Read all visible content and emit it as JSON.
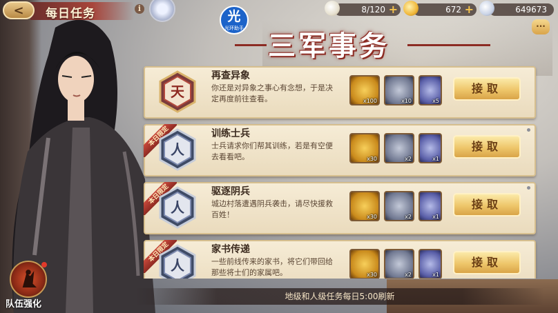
{
  "header": {
    "back_label": "<",
    "title": "每日任务",
    "info_label": "i",
    "logo_glyph": "光",
    "logo_sub": "光环助手",
    "resources": [
      {
        "name": "stamina",
        "value": "8/120",
        "icon": "bun-icon"
      },
      {
        "name": "gold-ingot",
        "value": "672",
        "icon": "gold-ingot-icon"
      },
      {
        "name": "coins",
        "value": "649673",
        "icon": "coin-icon"
      }
    ],
    "plus": "+",
    "chat_label": "···"
  },
  "main_title": "三军事务",
  "tasks": [
    {
      "name": "再查异象",
      "desc": "你还是对异象之事心有念想，于是决定再度前往查看。",
      "grade": "天",
      "ribbon": "",
      "rewards": [
        "x100",
        "x10",
        "x5"
      ],
      "accept": "接取"
    },
    {
      "name": "训练士兵",
      "desc": "士兵请求你们帮其训练，若是有空便去看看吧。",
      "grade": "人",
      "ribbon": "本日限定",
      "rewards": [
        "x30",
        "x2",
        "x1"
      ],
      "accept": "接取"
    },
    {
      "name": "驱逐阴兵",
      "desc": "城边村落遭遇阴兵袭击，请尽快援救百姓！",
      "grade": "人",
      "ribbon": "本日限定",
      "rewards": [
        "x30",
        "x2",
        "x1"
      ],
      "accept": "接取"
    },
    {
      "name": "家书传递",
      "desc": "一些前线传来的家书，将它们带回给那些将士们的家属吧。",
      "grade": "人",
      "ribbon": "本日限定",
      "rewards": [
        "x30",
        "x2",
        "x1"
      ],
      "accept": "接取"
    }
  ],
  "footer": "地级和人级任务每日5:00刷新",
  "team_button": "队伍强化",
  "colors": {
    "accent": "#8c2b23",
    "gold": "#eec66a",
    "card": "#f6ecd6"
  }
}
